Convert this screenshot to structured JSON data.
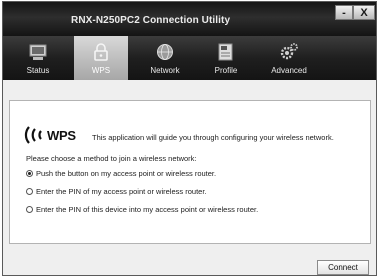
{
  "window": {
    "title": "RNX-N250PC2 Connection Utility",
    "minimize_label": "-",
    "close_label": "X"
  },
  "tabs": [
    {
      "label": "Status",
      "icon": "monitor-icon",
      "active": false
    },
    {
      "label": "WPS",
      "icon": "lock-icon",
      "active": true
    },
    {
      "label": "Network",
      "icon": "globe-icon",
      "active": false
    },
    {
      "label": "Profile",
      "icon": "profile-icon",
      "active": false
    },
    {
      "label": "Advanced",
      "icon": "gears-icon",
      "active": false
    }
  ],
  "panel": {
    "logo_text": "WPS",
    "intro": "This application will guide you through configuring your wireless network.",
    "choose_label": "Please choose a method to join a wireless network:",
    "options": [
      {
        "label": "Push the button on my access point or wireless router.",
        "selected": true
      },
      {
        "label": "Enter the PIN of my access point or wireless router.",
        "selected": false
      },
      {
        "label": "Enter the PIN of this device into my access point or wireless router.",
        "selected": false
      }
    ]
  },
  "footer": {
    "connect_label": "Connect"
  }
}
